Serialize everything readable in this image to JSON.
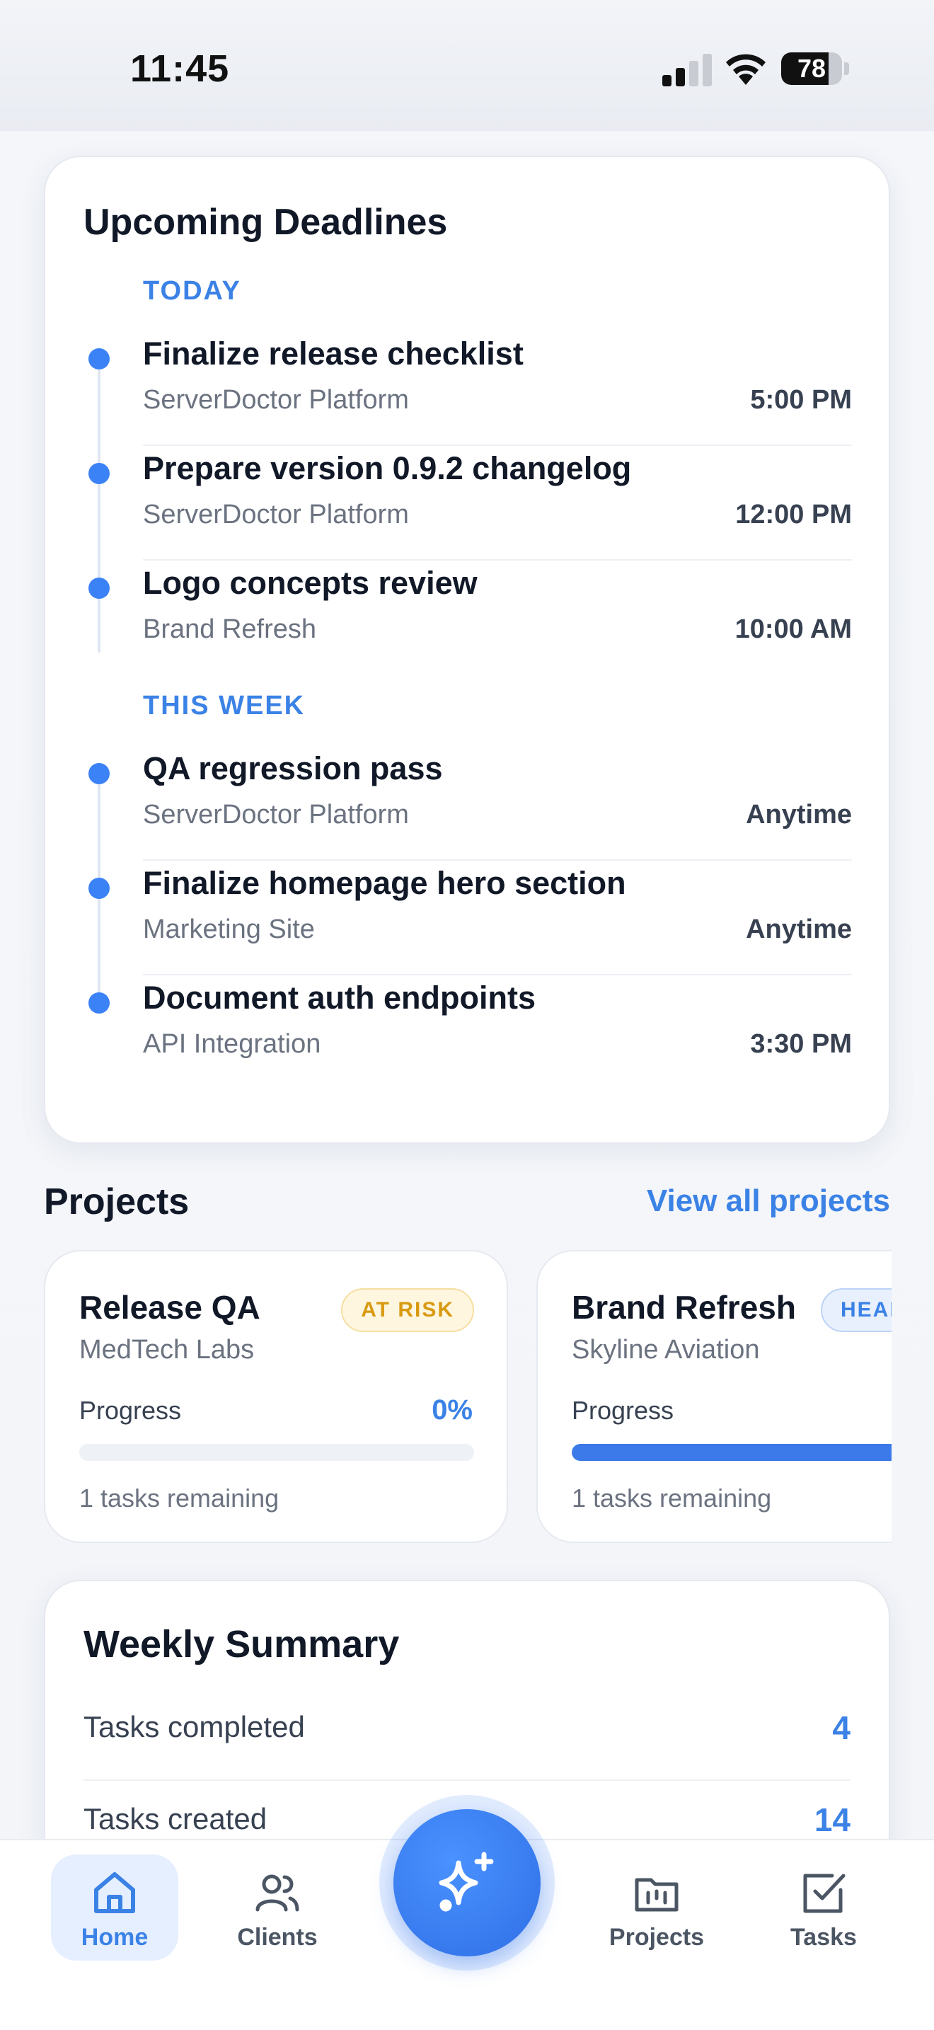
{
  "status_bar": {
    "time": "11:45",
    "battery": "78",
    "battery_level": 0.78
  },
  "deadlines": {
    "title": "Upcoming Deadlines",
    "groups": [
      {
        "label": "TODAY",
        "items": [
          {
            "title": "Finalize release checklist",
            "project": "ServerDoctor Platform",
            "time": "5:00 PM"
          },
          {
            "title": "Prepare version 0.9.2 changelog",
            "project": "ServerDoctor Platform",
            "time": "12:00 PM"
          },
          {
            "title": "Logo concepts review",
            "project": "Brand Refresh",
            "time": "10:00 AM"
          }
        ]
      },
      {
        "label": "THIS WEEK",
        "items": [
          {
            "title": "QA regression pass",
            "project": "ServerDoctor Platform",
            "time": "Anytime"
          },
          {
            "title": "Finalize homepage hero section",
            "project": "Marketing Site",
            "time": "Anytime"
          },
          {
            "title": "Document auth endpoints",
            "project": "API Integration",
            "time": "3:30 PM"
          }
        ]
      }
    ]
  },
  "projects": {
    "title": "Projects",
    "view_all": "View all projects",
    "items": [
      {
        "name": "Release QA",
        "client": "MedTech Labs",
        "badge": "AT RISK",
        "progress_label": "Progress",
        "progress_text": "0%",
        "progress": 0,
        "remaining": "1 tasks remaining"
      },
      {
        "name": "Brand Refresh",
        "client": "Skyline Aviation",
        "badge": "HEALTHY",
        "progress_label": "Progress",
        "progress_text": "",
        "progress": 0.8,
        "remaining": "1 tasks remaining"
      }
    ]
  },
  "weekly_summary": {
    "title": "Weekly Summary",
    "rows": [
      {
        "label": "Tasks completed",
        "value": "4"
      },
      {
        "label": "Tasks created",
        "value": "14"
      }
    ]
  },
  "tab_bar": {
    "home": "Home",
    "clients": "Clients",
    "projects": "Projects",
    "tasks": "Tasks",
    "fab_icon": "sparkles-icon"
  },
  "colors": {
    "accent": "#3b82f6",
    "warning": "#d99a12"
  }
}
